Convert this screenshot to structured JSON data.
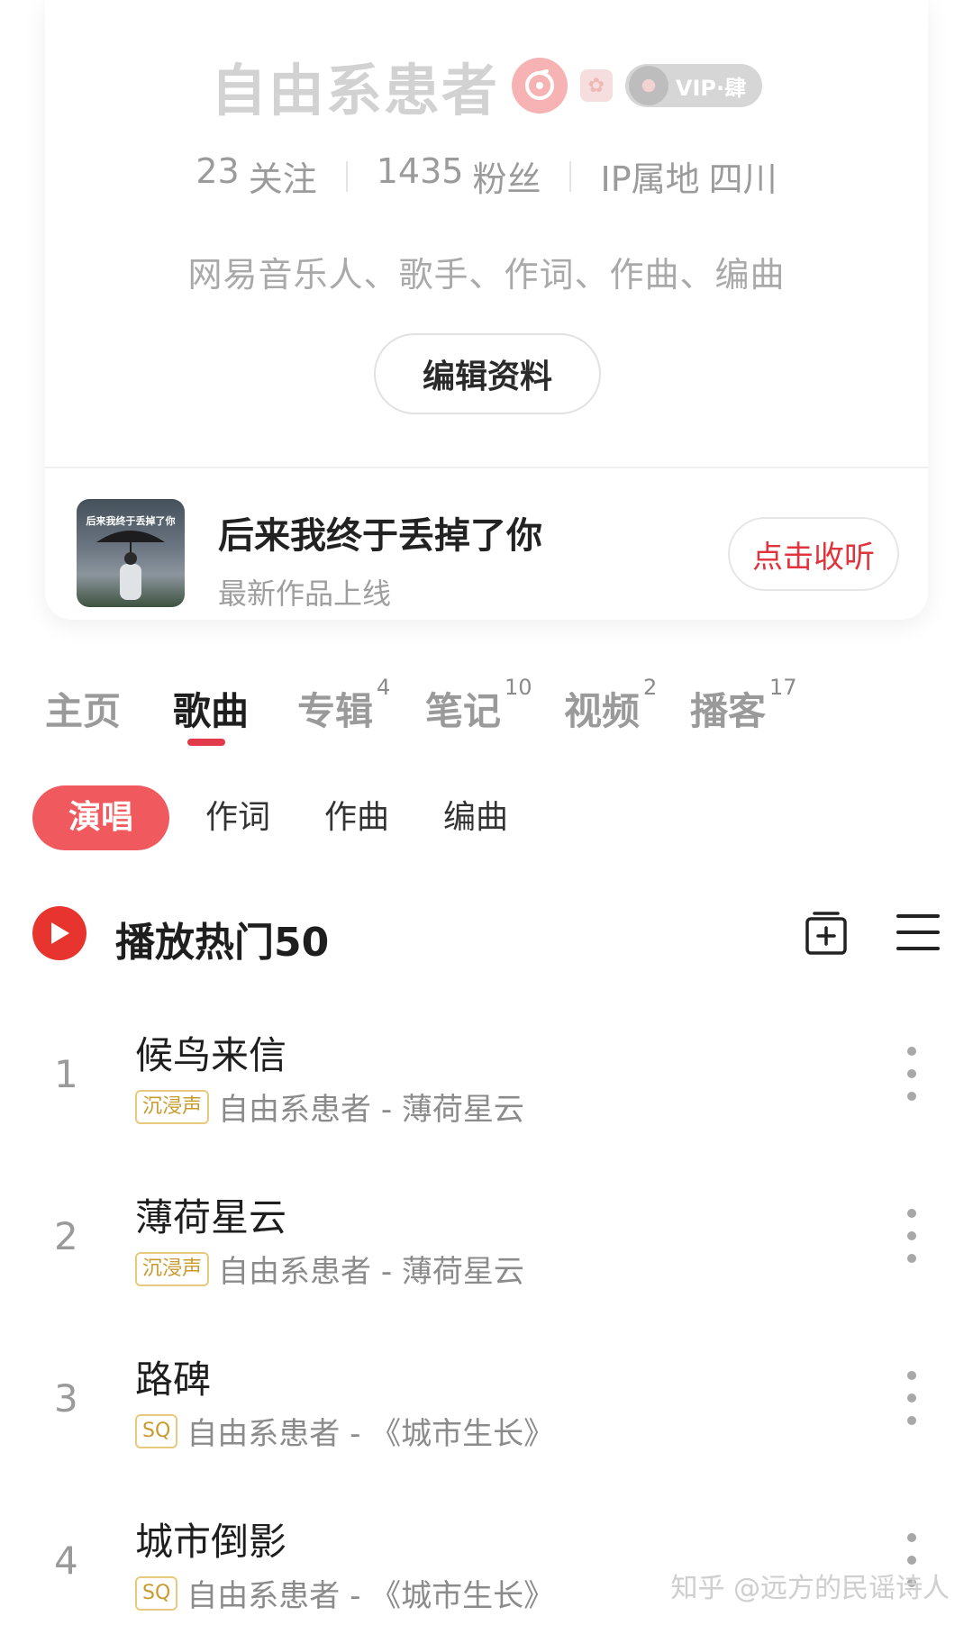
{
  "profile": {
    "username": "自由系患者",
    "vip_label": "VIP·肆",
    "stats": [
      {
        "value": "23",
        "label": "关注"
      },
      {
        "value": "1435",
        "label": "粉丝"
      },
      {
        "value": "IP属地",
        "label": "四川"
      }
    ],
    "bio": "网易音乐人、歌手、作词、作曲、编曲",
    "edit_button": "编辑资料"
  },
  "latest_release": {
    "cover_text": "后来我终于丢掉了你",
    "title": "后来我终于丢掉了你",
    "subtitle": "最新作品上线",
    "button": "点击收听"
  },
  "tabs": [
    {
      "label": "主页",
      "count": ""
    },
    {
      "label": "歌曲",
      "count": ""
    },
    {
      "label": "专辑",
      "count": "4"
    },
    {
      "label": "笔记",
      "count": "10"
    },
    {
      "label": "视频",
      "count": "2"
    },
    {
      "label": "播客",
      "count": "17"
    }
  ],
  "active_tab": "歌曲",
  "filters": [
    "演唱",
    "作词",
    "作曲",
    "编曲"
  ],
  "hot_section": {
    "title": "播放热门50"
  },
  "songs": [
    {
      "index": "1",
      "title": "候鸟来信",
      "tag": "沉浸声",
      "meta": "自由系患者 - 薄荷星云"
    },
    {
      "index": "2",
      "title": "薄荷星云",
      "tag": "沉浸声",
      "meta": "自由系患者 - 薄荷星云"
    },
    {
      "index": "3",
      "title": "路碑",
      "tag": "SQ",
      "meta": "自由系患者 - 《城市生长》"
    },
    {
      "index": "4",
      "title": "城市倒影",
      "tag": "SQ",
      "meta": "自由系患者 - 《城市生长》"
    }
  ],
  "watermark": "知乎 @远方的民谣诗人",
  "colors": {
    "accent": "#e23a4a",
    "chip_active": "#f05a5e",
    "play_icon": "#e8342f",
    "quality_tag": "#c99a2e"
  }
}
